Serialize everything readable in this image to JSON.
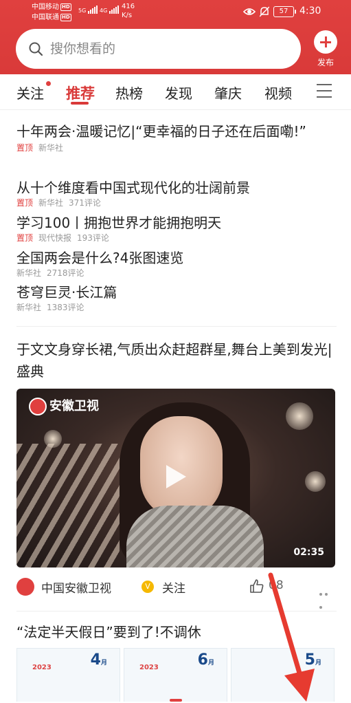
{
  "status_bar": {
    "carrier_1": "中国移动",
    "carrier_2": "中国联通",
    "hd": "HD",
    "net_1": "5G",
    "net_2": "4G",
    "speed_value": "416",
    "speed_unit": "K/s",
    "battery": "57",
    "time": "4:30"
  },
  "search": {
    "placeholder": "搜你想看的"
  },
  "publish": {
    "label": "发布"
  },
  "tabs": [
    {
      "label": "关注",
      "has_dot": true
    },
    {
      "label": "推荐",
      "active": true
    },
    {
      "label": "热榜"
    },
    {
      "label": "发现"
    },
    {
      "label": "肇庆"
    },
    {
      "label": "视频"
    }
  ],
  "pinned_news": [
    {
      "title": "十年两会·温暖记忆|“更幸福的日子还在后面嘞!”",
      "tag": "置顶",
      "source": "新华社",
      "comments": ""
    },
    {
      "title": "从十个维度看中国式现代化的壮阔前景",
      "tag": "置顶",
      "source": "新华社",
      "comments": "371评论"
    },
    {
      "title": "学习100丨拥抱世界才能拥抱明天",
      "tag": "置顶",
      "source": "现代快报",
      "comments": "193评论"
    },
    {
      "title": "全国两会是什么?4张图速览",
      "tag": "",
      "source": "新华社",
      "comments": "2718评论"
    },
    {
      "title": "苍穹巨灵·长江篇",
      "tag": "",
      "source": "新华社",
      "comments": "1383评论"
    }
  ],
  "video_post": {
    "title": "于文文身穿长裙,气质出众赶超群星,舞台上美到发光|盛典",
    "channel_watermark": "安徽卫视",
    "duration": "02:35",
    "source": "中国安徽卫视",
    "follow_label": "关注",
    "likes": "08"
  },
  "next_post": {
    "title": "“法定半天假日”要到了!不调休",
    "calendars": [
      {
        "month": "4",
        "unit": "月",
        "year": "2023"
      },
      {
        "month": "6",
        "unit": "月",
        "year": "2023"
      },
      {
        "month": "5",
        "unit": "月",
        "year": ""
      }
    ]
  },
  "colors": {
    "brand_red": "#d93a39",
    "pin_red": "#e0403f"
  }
}
